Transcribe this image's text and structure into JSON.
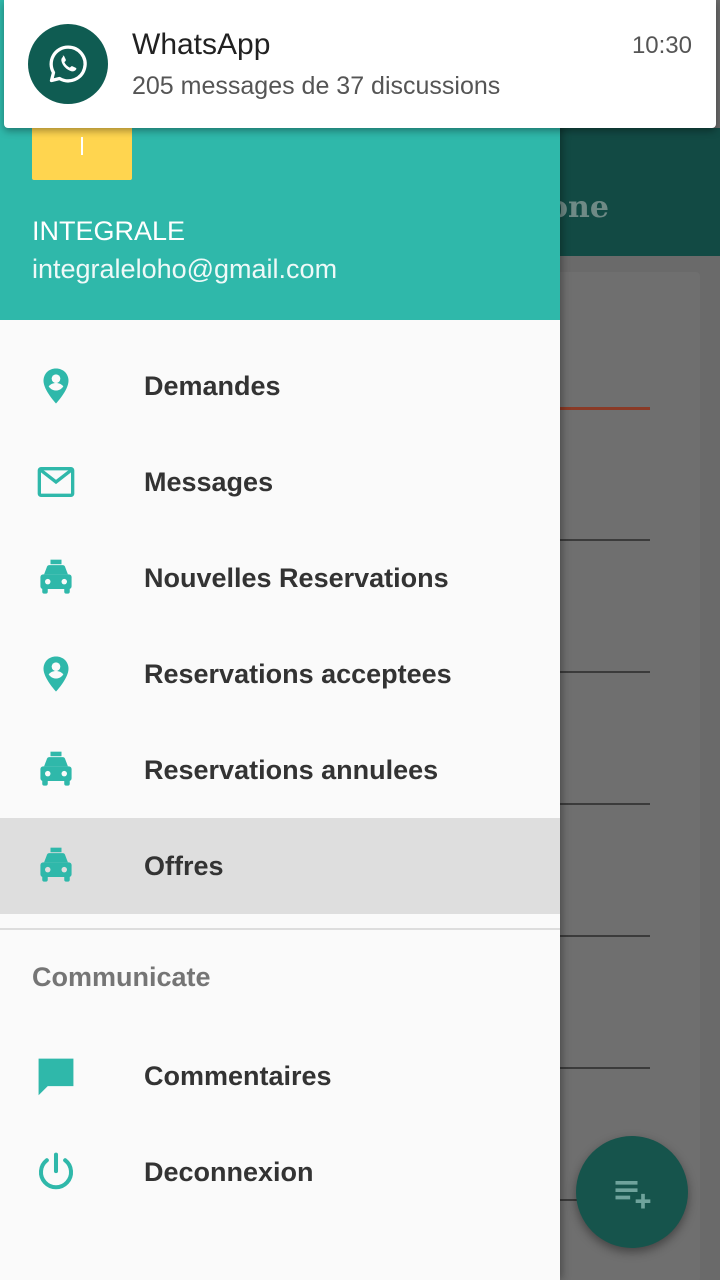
{
  "notification": {
    "app_name": "WhatsApp",
    "message": "205 messages de 37 discussions",
    "time": "10:30",
    "icon": "whatsapp-icon"
  },
  "background": {
    "toolbar_title_fragment": "one",
    "fab_icon": "playlist-add-icon"
  },
  "drawer": {
    "header": {
      "avatar_icon": "profile-avatar",
      "name": "INTEGRALE",
      "email": "integraleloho@gmail.com"
    },
    "items": [
      {
        "label": "Demandes",
        "icon": "location-pin-icon"
      },
      {
        "label": "Messages",
        "icon": "mail-icon"
      },
      {
        "label": "Nouvelles Reservations",
        "icon": "taxi-icon"
      },
      {
        "label": "Reservations acceptees",
        "icon": "location-pin-icon"
      },
      {
        "label": "Reservations annulees",
        "icon": "taxi-icon"
      },
      {
        "label": "Offres",
        "icon": "taxi-icon",
        "selected": true
      }
    ],
    "section_title": "Communicate",
    "section_items": [
      {
        "label": "Commentaires",
        "icon": "comment-icon"
      },
      {
        "label": "Deconnexion",
        "icon": "power-icon"
      }
    ]
  },
  "colors": {
    "accent": "#2fb8aa",
    "header_bg": "#2fb8aa",
    "avatar_bg": "#ffd54f",
    "selected_bg": "#dedede",
    "notification_icon_bg": "#0f5c52"
  }
}
